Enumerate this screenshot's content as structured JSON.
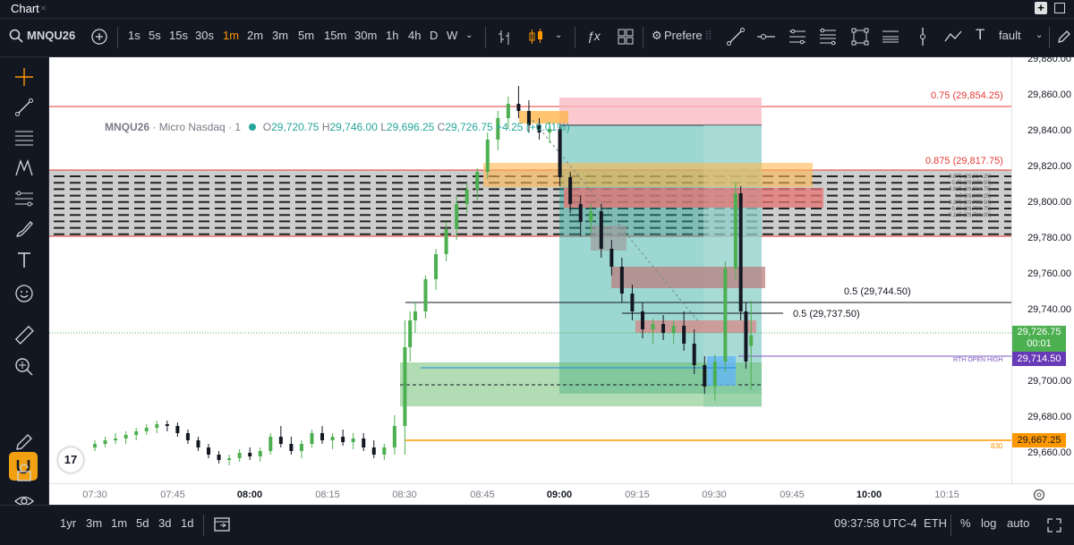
{
  "window": {
    "tab_title": "Chart",
    "close_glyph": "×"
  },
  "toolbar": {
    "symbol": "MNQU26",
    "intervals": [
      "1s",
      "5s",
      "15s",
      "30s",
      "1m",
      "2m",
      "3m",
      "5m",
      "15m",
      "30m",
      "1h",
      "4h",
      "D",
      "W"
    ],
    "active_interval": "1m",
    "indicators_label": "ƒx",
    "preferences_label": "Prefere",
    "template_label": "fault"
  },
  "legend": {
    "symbol": "MNQU26",
    "description": "· Micro Nasdaq · 1",
    "o_label": "O",
    "o": "29,720.75",
    "h_label": "H",
    "h": "29,746.00",
    "l_label": "L",
    "l": "29,696.25",
    "c_label": "C",
    "c": "29,726.75",
    "change": "+4.25 (+0.01%)"
  },
  "price_axis": {
    "ticks": [
      "29,880.00",
      "29,860.00",
      "29,840.00",
      "29,820.00",
      "29,800.00",
      "29,780.00",
      "29,760.00",
      "29,740.00",
      "29,720.00",
      "29,700.00",
      "29,680.00",
      "29,660.00"
    ],
    "last_price": "29,726.75",
    "countdown": "00:01",
    "rth_price": "29,714.50",
    "orange_price": "29,667.25"
  },
  "time_axis": {
    "ticks": [
      "07:30",
      "07:45",
      "08:00",
      "08:15",
      "08:30",
      "08:45",
      "09:00",
      "09:15",
      "09:30",
      "09:45",
      "10:00",
      "10:15"
    ],
    "bold": [
      "08:00",
      "09:00",
      "10:00"
    ]
  },
  "annotations": {
    "fib_075": "0.75 (29,854.25)",
    "fib_0875": "0.875 (29,817.75)",
    "half_1": "0.5 (29,744.50)",
    "half_2": "0.5 (29,737.50)",
    "rth": "RTH OPEN HIGH",
    "orange": "830",
    "small_fibs": [
      "0.875 (29,814.25)",
      "0.75 (29,809.50)",
      "0.625 (29,804.75)",
      "0.5 (29,800.25)",
      "0.375 (29,795.50)",
      "0.25 (29,790.75)",
      "0.125 (29,786.00)"
    ]
  },
  "bottom": {
    "ranges": [
      "1yr",
      "3m",
      "1m",
      "5d",
      "3d",
      "1d"
    ],
    "time": "09:37:58 UTC-4",
    "session": "ETH",
    "percent": "%",
    "log": "log",
    "auto": "auto"
  },
  "colors": {
    "up": "#4caf50",
    "down": "#131722",
    "accent": "#ff9800"
  },
  "chart_data": {
    "type": "candlestick",
    "symbol": "MNQU26",
    "interval": "1m",
    "ylim": [
      29655,
      29885
    ],
    "xlim": [
      "07:23",
      "10:25"
    ],
    "candles": [
      [
        "07:30",
        29664,
        29668,
        29662,
        29666
      ],
      [
        "07:32",
        29666,
        29670,
        29664,
        29668
      ],
      [
        "07:34",
        29668,
        29672,
        29666,
        29669
      ],
      [
        "07:36",
        29669,
        29673,
        29666,
        29671
      ],
      [
        "07:38",
        29671,
        29675,
        29668,
        29673
      ],
      [
        "07:40",
        29673,
        29677,
        29671,
        29675
      ],
      [
        "07:42",
        29675,
        29679,
        29672,
        29677
      ],
      [
        "07:44",
        29677,
        29679,
        29673,
        29676
      ],
      [
        "07:46",
        29676,
        29678,
        29670,
        29672
      ],
      [
        "07:48",
        29672,
        29674,
        29666,
        29668
      ],
      [
        "07:50",
        29668,
        29670,
        29662,
        29664
      ],
      [
        "07:52",
        29664,
        29666,
        29658,
        29660
      ],
      [
        "07:54",
        29660,
        29662,
        29655,
        29657
      ],
      [
        "07:56",
        29657,
        29660,
        29654,
        29658
      ],
      [
        "07:58",
        29658,
        29663,
        29656,
        29661
      ],
      [
        "08:00",
        29661,
        29664,
        29657,
        29659
      ],
      [
        "08:02",
        29659,
        29664,
        29656,
        29662
      ],
      [
        "08:04",
        29662,
        29672,
        29660,
        29670
      ],
      [
        "08:06",
        29670,
        29676,
        29664,
        29666
      ],
      [
        "08:08",
        29666,
        29670,
        29660,
        29662
      ],
      [
        "08:10",
        29662,
        29668,
        29658,
        29666
      ],
      [
        "08:12",
        29666,
        29674,
        29664,
        29672
      ],
      [
        "08:14",
        29672,
        29676,
        29666,
        29668
      ],
      [
        "08:16",
        29668,
        29672,
        29663,
        29670
      ],
      [
        "08:18",
        29670,
        29674,
        29665,
        29667
      ],
      [
        "08:20",
        29667,
        29672,
        29663,
        29669
      ],
      [
        "08:22",
        29669,
        29672,
        29662,
        29664
      ],
      [
        "08:24",
        29664,
        29668,
        29658,
        29660
      ],
      [
        "08:26",
        29660,
        29666,
        29657,
        29664
      ],
      [
        "08:28",
        29664,
        29682,
        29660,
        29676
      ],
      [
        "08:30",
        29676,
        29735,
        29660,
        29720
      ],
      [
        "08:31",
        29720,
        29740,
        29712,
        29735
      ],
      [
        "08:32",
        29735,
        29745,
        29728,
        29740
      ],
      [
        "08:34",
        29740,
        29760,
        29736,
        29758
      ],
      [
        "08:36",
        29758,
        29775,
        29752,
        29772
      ],
      [
        "08:38",
        29772,
        29790,
        29768,
        29786
      ],
      [
        "08:40",
        29786,
        29805,
        29780,
        29800
      ],
      [
        "08:42",
        29800,
        29812,
        29795,
        29808
      ],
      [
        "08:44",
        29808,
        29820,
        29802,
        29818
      ],
      [
        "08:46",
        29818,
        29840,
        29814,
        29836
      ],
      [
        "08:48",
        29836,
        29852,
        29830,
        29848
      ],
      [
        "08:50",
        29848,
        29860,
        29842,
        29856
      ],
      [
        "08:52",
        29856,
        29866,
        29848,
        29852
      ],
      [
        "08:54",
        29852,
        29858,
        29840,
        29844
      ],
      [
        "08:56",
        29844,
        29848,
        29836,
        29840
      ],
      [
        "08:58",
        29840,
        29846,
        29834,
        29842
      ],
      [
        "09:00",
        29842,
        29845,
        29810,
        29815
      ],
      [
        "09:02",
        29815,
        29818,
        29795,
        29800
      ],
      [
        "09:04",
        29800,
        29805,
        29782,
        29790
      ],
      [
        "09:06",
        29790,
        29800,
        29784,
        29796
      ],
      [
        "09:08",
        29796,
        29800,
        29770,
        29775
      ],
      [
        "09:10",
        29775,
        29780,
        29760,
        29765
      ],
      [
        "09:12",
        29765,
        29770,
        29745,
        29750
      ],
      [
        "09:14",
        29750,
        29755,
        29735,
        29740
      ],
      [
        "09:16",
        29740,
        29745,
        29725,
        29730
      ],
      [
        "09:18",
        29730,
        29736,
        29722,
        29733
      ],
      [
        "09:20",
        29733,
        29738,
        29724,
        29728
      ],
      [
        "09:22",
        29728,
        29735,
        29722,
        29732
      ],
      [
        "09:24",
        29732,
        29740,
        29718,
        29722
      ],
      [
        "09:26",
        29722,
        29730,
        29705,
        29710
      ],
      [
        "09:28",
        29710,
        29715,
        29694,
        29698
      ],
      [
        "09:30",
        29698,
        29716,
        29690,
        29712
      ],
      [
        "09:32",
        29712,
        29768,
        29706,
        29764
      ],
      [
        "09:34",
        29764,
        29812,
        29758,
        29806
      ],
      [
        "09:35",
        29806,
        29810,
        29735,
        29740
      ],
      [
        "09:36",
        29740,
        29745,
        29708,
        29712
      ],
      [
        "09:37",
        29720.75,
        29746,
        29696.25,
        29726.75
      ]
    ]
  }
}
